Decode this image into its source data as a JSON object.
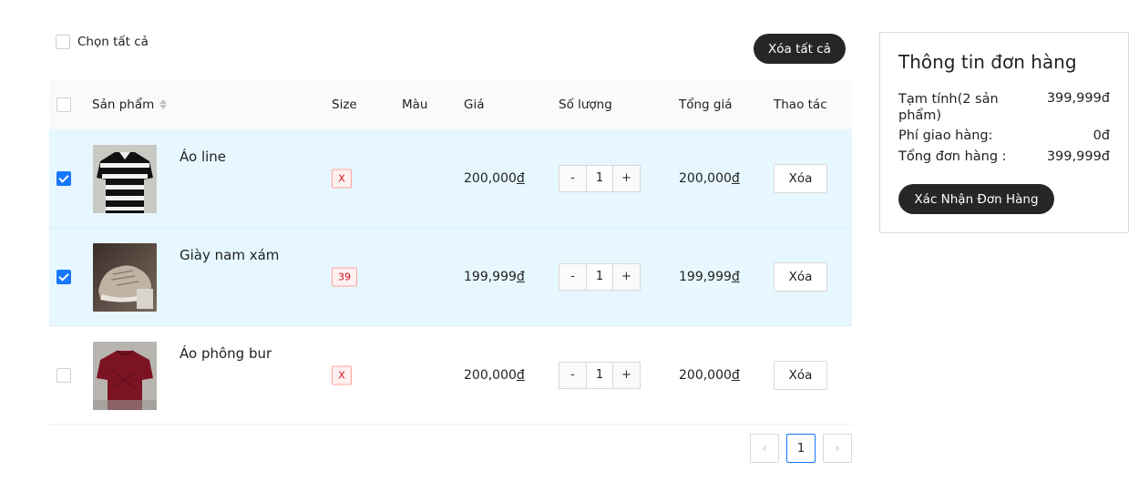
{
  "toolbar": {
    "select_all_label": "Chọn tất cả",
    "clear_all_label": "Xóa tất cả"
  },
  "table": {
    "headers": {
      "product": "Sản phẩm",
      "size": "Size",
      "color": "Màu",
      "price": "Giá",
      "quantity": "Số lượng",
      "total": "Tổng giá",
      "action": "Thao tác"
    },
    "currency_symbol": "đ",
    "rows": [
      {
        "selected": true,
        "name": "Áo line",
        "size": "X",
        "color": "",
        "price": "200,000",
        "qty": "1",
        "total": "200,000",
        "delete_label": "Xóa",
        "thumb": "black-white-striped-shirt"
      },
      {
        "selected": true,
        "name": "Giày nam xám",
        "size": "39",
        "color": "",
        "price": "199,999",
        "qty": "1",
        "total": "199,999",
        "delete_label": "Xóa",
        "thumb": "grey-sneaker"
      },
      {
        "selected": false,
        "name": "Áo phông bur",
        "size": "X",
        "color": "",
        "price": "200,000",
        "qty": "1",
        "total": "200,000",
        "delete_label": "Xóa",
        "thumb": "maroon-tshirt"
      }
    ],
    "qty_minus": "-",
    "qty_plus": "+"
  },
  "pagination": {
    "prev": "‹",
    "current": "1",
    "next": "›"
  },
  "summary": {
    "title": "Thông tin đơn hàng",
    "subtotal_label": "Tạm tính(2 sản phẩm)",
    "subtotal_value": "399,999đ",
    "shipping_label": "Phí giao hàng:",
    "shipping_value": "0đ",
    "total_label": "Tổng đơn hàng :",
    "total_value": "399,999đ",
    "confirm_label": "Xác Nhận Đơn Hàng"
  },
  "colors": {
    "selected_row_bg": "#e6f7ff",
    "checkbox_on": "#1677ff",
    "dark_button": "#262626",
    "size_tag_text": "#cf1322"
  }
}
